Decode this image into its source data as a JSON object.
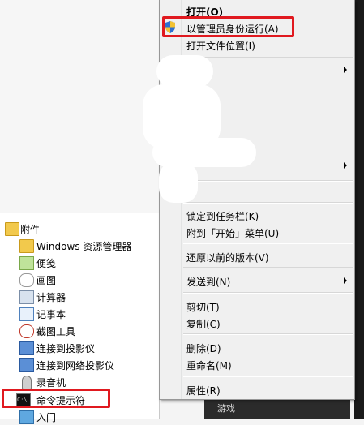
{
  "context_menu": {
    "items": [
      {
        "label": "打开(O)",
        "bold": true
      },
      {
        "label": "以管理员身份运行(A)"
      },
      {
        "label": "打开文件位置(I)"
      },
      {
        "label": "锁定到任务栏(K)"
      },
      {
        "label": "附到「开始」菜单(U)"
      },
      {
        "label": "还原以前的版本(V)"
      },
      {
        "label": "发送到(N)"
      },
      {
        "label": "剪切(T)"
      },
      {
        "label": "复制(C)"
      },
      {
        "label": "删除(D)"
      },
      {
        "label": "重命名(M)"
      },
      {
        "label": "属性(R)"
      }
    ]
  },
  "start_menu": {
    "folder": "附件",
    "items": [
      {
        "label": "Windows 资源管理器",
        "icon": "explorer-icon"
      },
      {
        "label": "便笺",
        "icon": "sticky-notes-icon"
      },
      {
        "label": "画图",
        "icon": "paint-icon"
      },
      {
        "label": "计算器",
        "icon": "calculator-icon"
      },
      {
        "label": "记事本",
        "icon": "notepad-icon"
      },
      {
        "label": "截图工具",
        "icon": "snipping-tool-icon"
      },
      {
        "label": "连接到投影仪",
        "icon": "projector-icon"
      },
      {
        "label": "连接到网络投影仪",
        "icon": "network-projector-icon"
      },
      {
        "label": "录音机",
        "icon": "microphone-icon"
      },
      {
        "label": "命令提示符",
        "icon": "cmd-icon"
      },
      {
        "label": "入门",
        "icon": "getting-started-icon"
      }
    ]
  },
  "behind": {
    "label": "游戏"
  },
  "colors": {
    "highlight_box": "#e0191f",
    "menu_bg": "#f0f0f0"
  }
}
